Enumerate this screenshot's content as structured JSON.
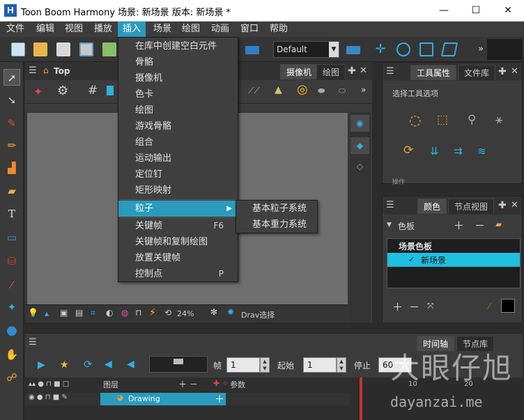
{
  "window": {
    "title": "Toon Boom Harmony 场景: 新场景 版本: 新场景 *",
    "logo_letter": "H",
    "minimize": "—",
    "maximize": "☐",
    "close": "✕"
  },
  "menubar": [
    "文件",
    "编辑",
    "视图",
    "播放",
    "插入",
    "场景",
    "绘图",
    "动画",
    "窗口",
    "帮助"
  ],
  "toolbar": {
    "preset": "Default",
    "overflow": "»"
  },
  "insert_menu": [
    {
      "label": "在库中创建空白元件",
      "shortcut": ""
    },
    {
      "label": "骨骼",
      "shortcut": ""
    },
    {
      "label": "摄像机",
      "shortcut": ""
    },
    {
      "label": "色卡",
      "shortcut": ""
    },
    {
      "label": "绘图",
      "shortcut": ""
    },
    {
      "label": "游戏骨骼",
      "shortcut": ""
    },
    {
      "label": "组合",
      "shortcut": ""
    },
    {
      "label": "运动输出",
      "shortcut": ""
    },
    {
      "label": "定位钉",
      "shortcut": ""
    },
    {
      "label": "矩形映射",
      "shortcut": ""
    },
    {
      "label": "粒子",
      "shortcut": "▶"
    },
    {
      "label": "关键帧",
      "shortcut": "F6"
    },
    {
      "label": "关键帧和复制绘图",
      "shortcut": ""
    },
    {
      "label": "放置关键帧",
      "shortcut": ""
    },
    {
      "label": "控制点",
      "shortcut": "P"
    }
  ],
  "particle_submenu": [
    "基本粒子系统",
    "基本重力系统"
  ],
  "camera_panel": {
    "breadcrumb": "Top",
    "tabs": [
      "摄像机",
      "绘图"
    ],
    "zoom": "24%",
    "draw_select": "Drav选择"
  },
  "tool_panel": {
    "tabs": [
      "工具属性",
      "文件库"
    ],
    "section_title": "选择工具选项",
    "footer_label": "操作"
  },
  "color_panel": {
    "tabs": [
      "颜色",
      "节点视图"
    ],
    "header": "色板",
    "list_header": "场景色板",
    "palette_item": "新场景"
  },
  "timeline": {
    "tabs": [
      "时间轴",
      "节点库"
    ],
    "frame_label": "帧",
    "frame_value": "1",
    "start_label": "起始",
    "start_value": "1",
    "stop_label": "停止",
    "stop_value": "60",
    "layers_header": "图层",
    "params_header": "参数",
    "layer_name": "Drawing",
    "ruler_marks": [
      "10",
      "20"
    ]
  },
  "watermark": {
    "cn": "大眼仔旭",
    "url": "dayanzai.me"
  },
  "colors": {
    "accent": "#2a9bbd",
    "selected_row": "#1fbfe0"
  }
}
